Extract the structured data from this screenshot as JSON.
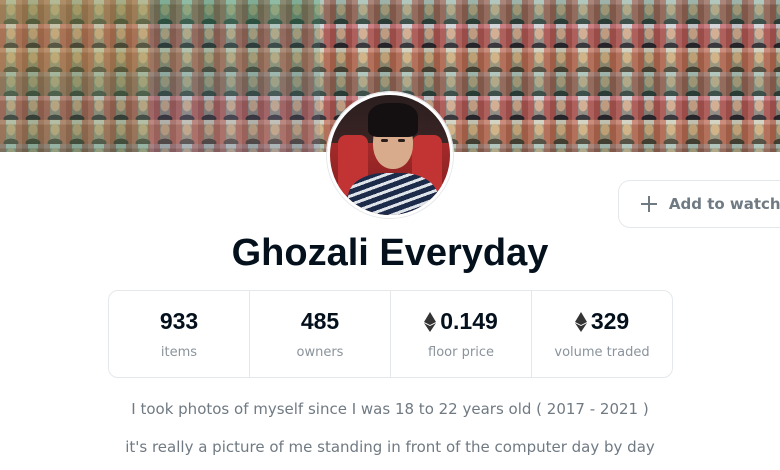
{
  "collection": {
    "name": "Ghozali Everyday"
  },
  "watchlist_button": {
    "label": "Add to watchlist"
  },
  "stats": [
    {
      "value": "933",
      "label": "items",
      "icon": null
    },
    {
      "value": "485",
      "label": "owners",
      "icon": null
    },
    {
      "value": "0.149",
      "label": "floor price",
      "icon": "ethereum-icon"
    },
    {
      "value": "329",
      "label": "volume traded",
      "icon": "ethereum-icon"
    }
  ],
  "description": {
    "line1": "I took photos of myself since I was 18 to 22 years old ( 2017 - 2021 )",
    "line2": "it's really a picture of me standing in front of the computer day by day"
  },
  "colors": {
    "text_primary": "#04111d",
    "text_secondary": "#707a83",
    "border": "#e5e8eb"
  }
}
